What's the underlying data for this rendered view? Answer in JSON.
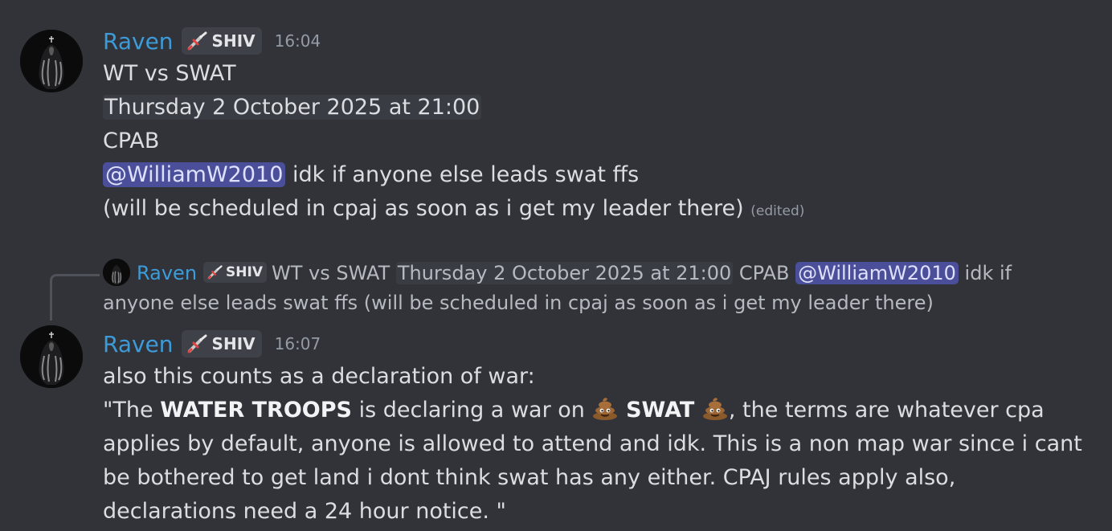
{
  "messages": [
    {
      "author": "Raven",
      "role": "SHIV",
      "time": "16:04",
      "lines": {
        "l1": "WT vs SWAT",
        "timestamp": "Thursday 2 October 2025 at 21:00",
        "l3": "CPAB",
        "mention": "@WilliamW2010",
        "l4_rest": " idk if anyone else leads swat ffs",
        "l5": "(will be scheduled in cpaj as soon as i get my leader there)",
        "edited": "(edited)"
      }
    },
    {
      "author": "Raven",
      "role": "SHIV",
      "time": "16:07",
      "reply": {
        "author": "Raven",
        "role": "SHIV",
        "t1": "WT vs SWAT ",
        "timestamp": "Thursday 2 October 2025 at 21:00",
        "t2": " CPAB ",
        "mention": "@WilliamW2010",
        "t3": " idk if anyone else leads swat ffs (will be scheduled in cpaj as soon as i get my leader there)"
      },
      "lines": {
        "l1": "also this counts as a declaration of war:",
        "q_open": "\"The ",
        "bold1": "WATER TROOPS",
        "q_mid": " is declaring a war on ",
        "bold2": "SWAT",
        "q_rest1": ", the terms are whatever cpa",
        "l3": "applies by default, anyone is allowed to attend and idk. This is a non map war since i cant",
        "l4": "be bothered to get land i dont think swat has any either. CPAJ rules apply also,",
        "l5": "declarations need a 24 hour notice. \""
      }
    }
  ],
  "icons": {
    "role_icon": "dagger-icon",
    "emoji": "poop-emoji-icon"
  },
  "colors": {
    "background": "#323339",
    "author": "#3c9bd8",
    "mention_bg": "#4b4f9a",
    "mention_text": "#dee0fc",
    "timestamp_bg": "#3a3c43"
  }
}
